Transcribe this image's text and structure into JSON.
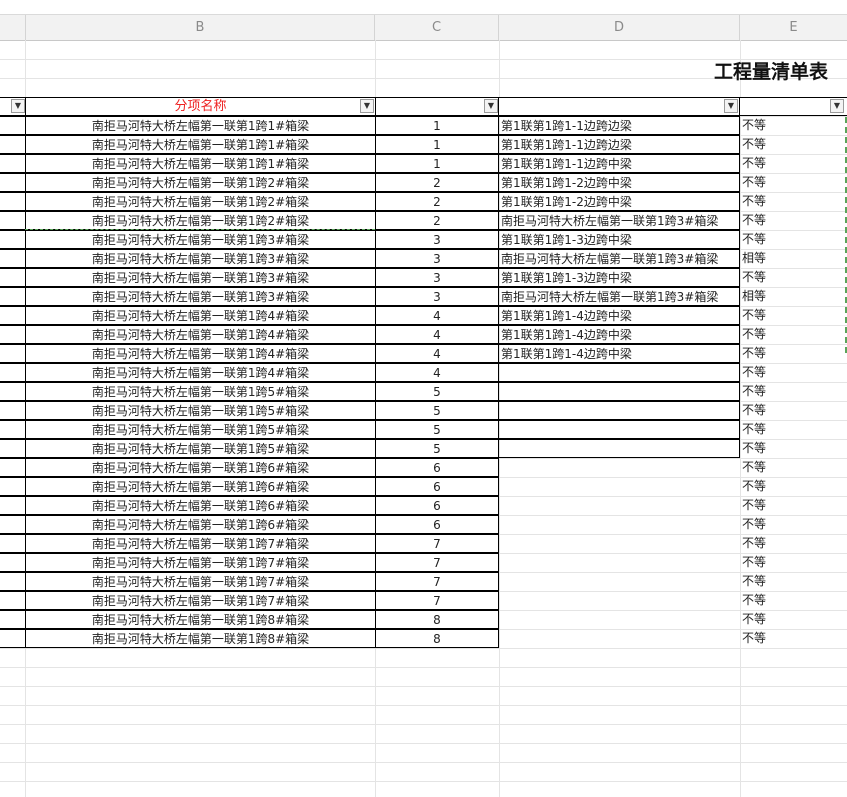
{
  "column_headers": [
    "B",
    "C",
    "D",
    "E"
  ],
  "title": "工程量清单表",
  "header": {
    "b_label": "分项名称"
  },
  "rows": [
    {
      "b": "南拒马河特大桥左幅第一联第1跨1#箱梁",
      "c": "1",
      "d": "第1联第1跨1-1边跨边梁",
      "e": "不等"
    },
    {
      "b": "南拒马河特大桥左幅第一联第1跨1#箱梁",
      "c": "1",
      "d": "第1联第1跨1-1边跨边梁",
      "e": "不等"
    },
    {
      "b": "南拒马河特大桥左幅第一联第1跨1#箱梁",
      "c": "1",
      "d": "第1联第1跨1-1边跨中梁",
      "e": "不等"
    },
    {
      "b": "南拒马河特大桥左幅第一联第1跨2#箱梁",
      "c": "2",
      "d": "第1联第1跨1-2边跨中梁",
      "e": "不等"
    },
    {
      "b": "南拒马河特大桥左幅第一联第1跨2#箱梁",
      "c": "2",
      "d": "第1联第1跨1-2边跨中梁",
      "e": "不等"
    },
    {
      "b": "南拒马河特大桥左幅第一联第1跨2#箱梁",
      "c": "2",
      "d": " 南拒马河特大桥左幅第一联第1跨3#箱梁",
      "e": "不等"
    },
    {
      "b": "南拒马河特大桥左幅第一联第1跨3#箱梁",
      "c": "3",
      "d": "第1联第1跨1-3边跨中梁",
      "e": "不等"
    },
    {
      "b": "南拒马河特大桥左幅第一联第1跨3#箱梁",
      "c": "3",
      "d": " 南拒马河特大桥左幅第一联第1跨3#箱梁",
      "e": "相等"
    },
    {
      "b": "南拒马河特大桥左幅第一联第1跨3#箱梁",
      "c": "3",
      "d": "第1联第1跨1-3边跨中梁",
      "e": "不等"
    },
    {
      "b": "南拒马河特大桥左幅第一联第1跨3#箱梁",
      "c": "3",
      "d": " 南拒马河特大桥左幅第一联第1跨3#箱梁",
      "e": "相等"
    },
    {
      "b": "南拒马河特大桥左幅第一联第1跨4#箱梁",
      "c": "4",
      "d": "第1联第1跨1-4边跨中梁",
      "e": "不等"
    },
    {
      "b": "南拒马河特大桥左幅第一联第1跨4#箱梁",
      "c": "4",
      "d": "第1联第1跨1-4边跨中梁",
      "e": "不等"
    },
    {
      "b": "南拒马河特大桥左幅第一联第1跨4#箱梁",
      "c": "4",
      "d": "第1联第1跨1-4边跨中梁",
      "e": "不等"
    },
    {
      "b": "南拒马河特大桥左幅第一联第1跨4#箱梁",
      "c": "4",
      "d": "",
      "e": "不等"
    },
    {
      "b": "南拒马河特大桥左幅第一联第1跨5#箱梁",
      "c": "5",
      "d": "",
      "e": "不等"
    },
    {
      "b": "南拒马河特大桥左幅第一联第1跨5#箱梁",
      "c": "5",
      "d": "",
      "e": "不等"
    },
    {
      "b": "南拒马河特大桥左幅第一联第1跨5#箱梁",
      "c": "5",
      "d": "",
      "e": "不等"
    },
    {
      "b": "南拒马河特大桥左幅第一联第1跨5#箱梁",
      "c": "5",
      "d": "",
      "e": "不等"
    },
    {
      "b": "南拒马河特大桥左幅第一联第1跨6#箱梁",
      "c": "6",
      "d": "",
      "e": "不等"
    },
    {
      "b": "南拒马河特大桥左幅第一联第1跨6#箱梁",
      "c": "6",
      "d": "",
      "e": "不等"
    },
    {
      "b": "南拒马河特大桥左幅第一联第1跨6#箱梁",
      "c": "6",
      "d": "",
      "e": "不等"
    },
    {
      "b": "南拒马河特大桥左幅第一联第1跨6#箱梁",
      "c": "6",
      "d": "",
      "e": "不等"
    },
    {
      "b": "南拒马河特大桥左幅第一联第1跨7#箱梁",
      "c": "7",
      "d": "",
      "e": "不等"
    },
    {
      "b": "南拒马河特大桥左幅第一联第1跨7#箱梁",
      "c": "7",
      "d": "",
      "e": "不等"
    },
    {
      "b": "南拒马河特大桥左幅第一联第1跨7#箱梁",
      "c": "7",
      "d": "",
      "e": "不等"
    },
    {
      "b": "南拒马河特大桥左幅第一联第1跨7#箱梁",
      "c": "7",
      "d": "",
      "e": "不等"
    },
    {
      "b": "南拒马河特大桥左幅第一联第1跨8#箱梁",
      "c": "8",
      "d": "",
      "e": "不等"
    },
    {
      "b": "南拒马河特大桥左幅第一联第1跨8#箱梁",
      "c": "8",
      "d": "",
      "e": "不等"
    }
  ],
  "icons": {
    "filter": "filter-dropdown-icon",
    "filter_active": "filter-active-icon"
  },
  "colors": {
    "header_text": "#e22222",
    "dashed_marquee": "#5aa55a"
  }
}
